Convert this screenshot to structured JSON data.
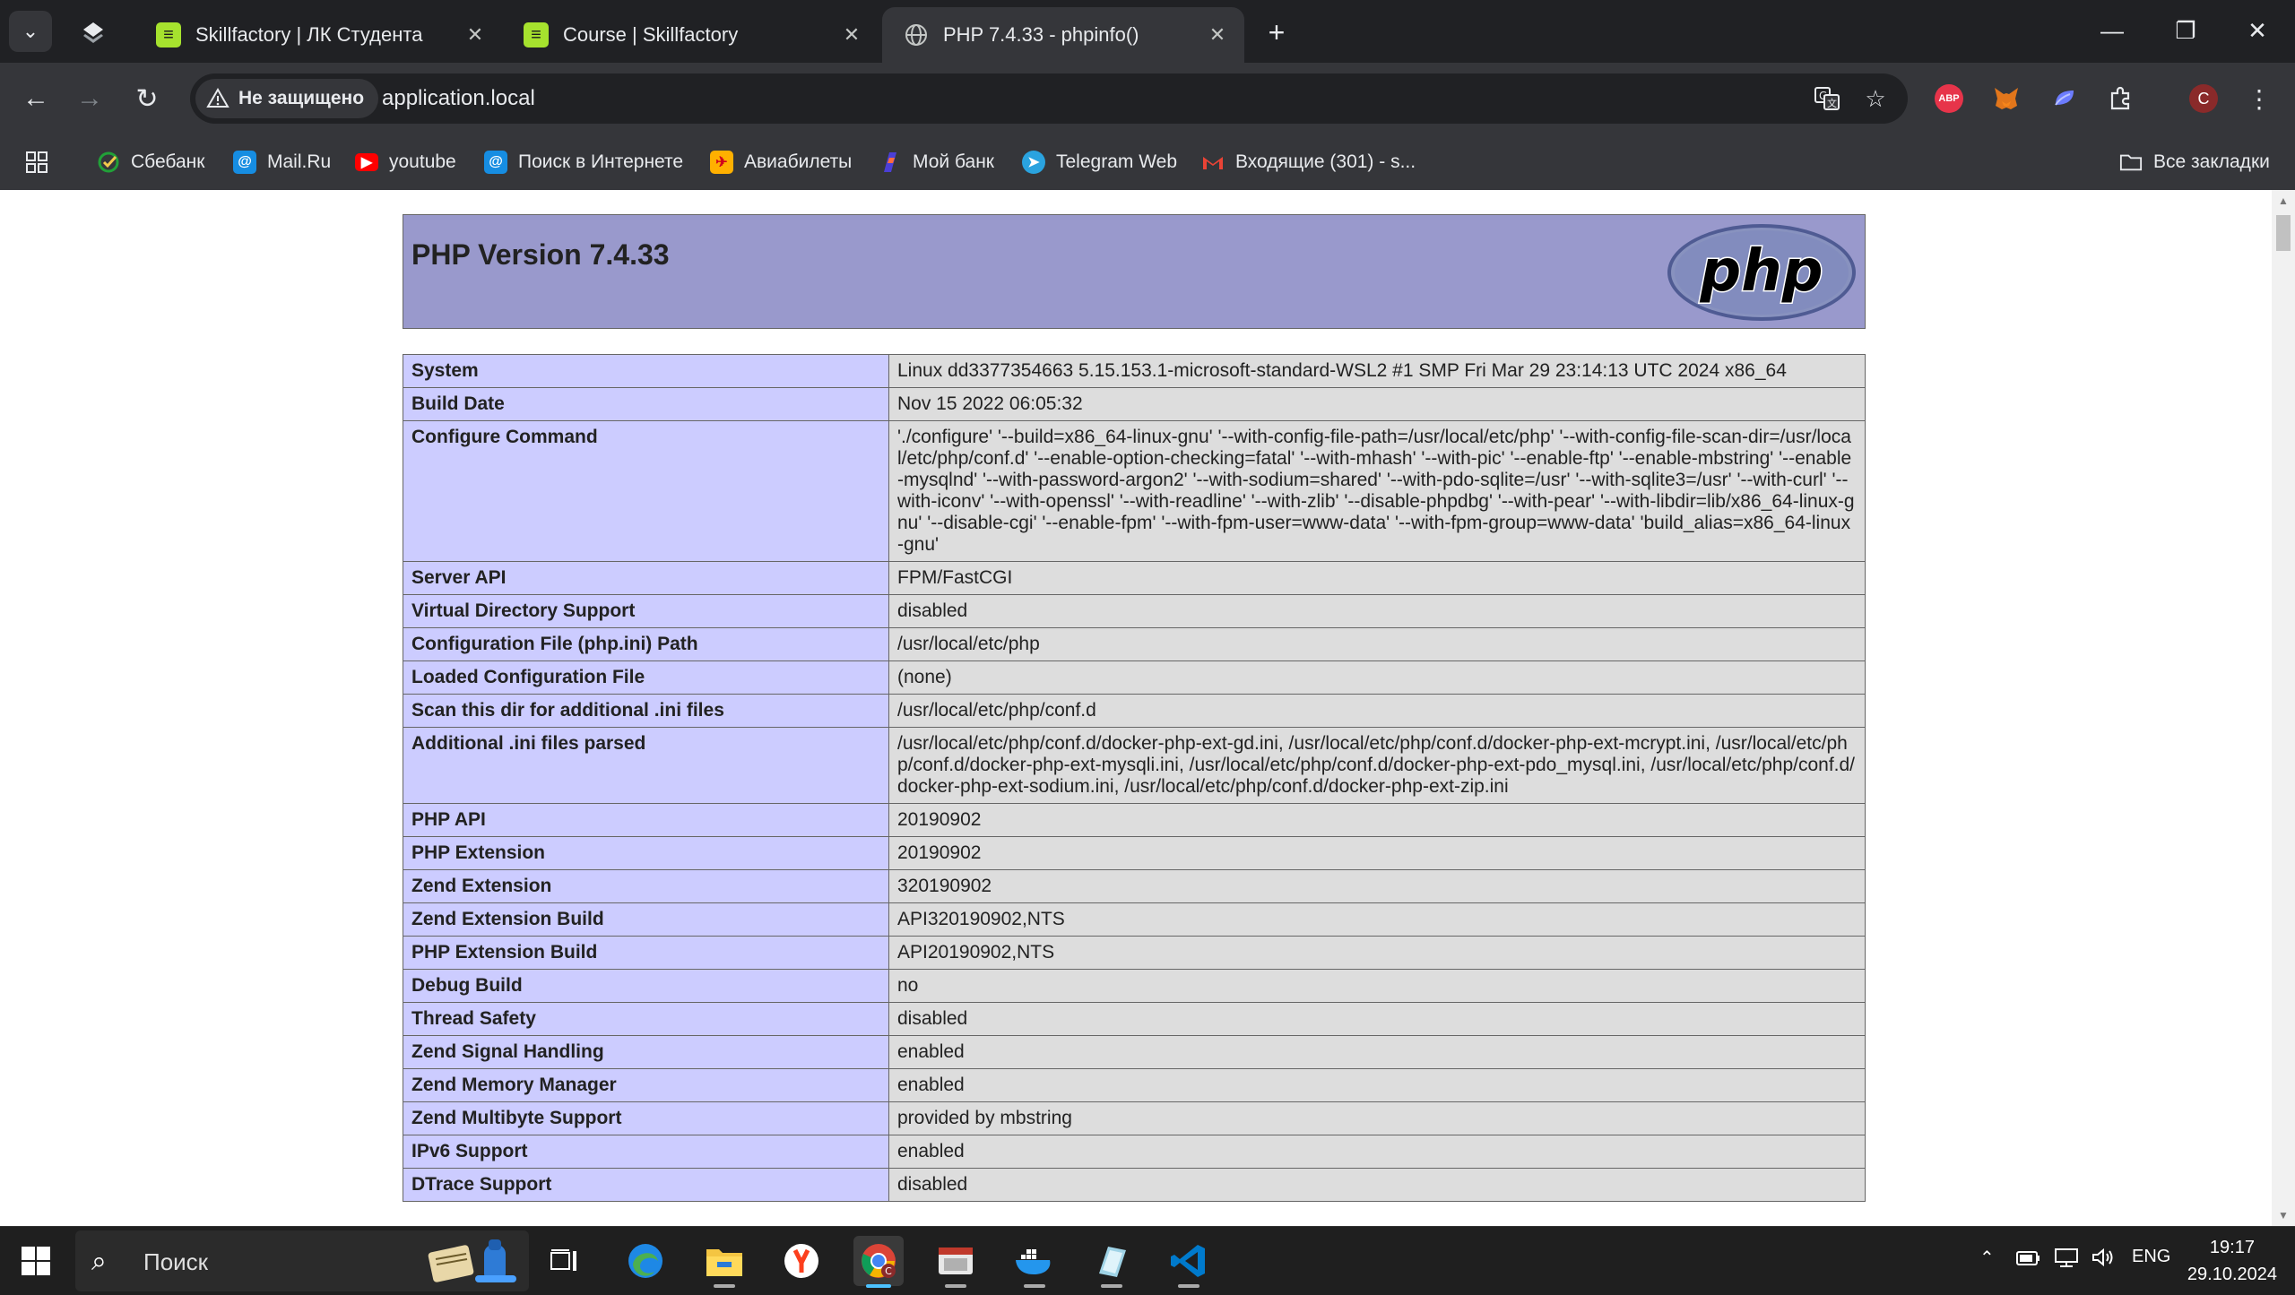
{
  "browser": {
    "tabs": [
      {
        "title": "Skillfactory | ЛК Студента",
        "favicon": "skillfactory-icon"
      },
      {
        "title": "Course | Skillfactory",
        "favicon": "skillfactory-icon"
      },
      {
        "title": "PHP 7.4.33 - phpinfo()",
        "favicon": "globe-icon",
        "active": true
      }
    ],
    "security_label": "Не защищено",
    "url": "application.local",
    "avatar_letter": "C",
    "abp_label": "ABP",
    "bookmarks": [
      {
        "label": "Сбебанк",
        "icon": "sber-icon"
      },
      {
        "label": "Mail.Ru",
        "icon": "mailru-icon"
      },
      {
        "label": "youtube",
        "icon": "youtube-icon"
      },
      {
        "label": "Поиск в Интернете",
        "icon": "search-at-icon"
      },
      {
        "label": "Авиабилеты",
        "icon": "tickets-icon"
      },
      {
        "label": "Мой банк",
        "icon": "bank-icon"
      },
      {
        "label": "Telegram Web",
        "icon": "telegram-icon"
      },
      {
        "label": "Входящие (301) - s...",
        "icon": "gmail-icon"
      }
    ],
    "all_bookmarks": "Все закладки",
    "colors": {
      "tabstrip": "#202124",
      "toolbar": "#35363a"
    }
  },
  "phpinfo": {
    "title": "PHP Version 7.4.33",
    "logo_text": "php",
    "rows": [
      {
        "k": "System",
        "v": "Linux dd3377354663 5.15.153.1-microsoft-standard-WSL2 #1 SMP Fri Mar 29 23:14:13 UTC 2024 x86_64"
      },
      {
        "k": "Build Date",
        "v": "Nov 15 2022 06:05:32"
      },
      {
        "k": "Configure Command",
        "v": "'./configure' '--build=x86_64-linux-gnu' '--with-config-file-path=/usr/local/etc/php' '--with-config-file-scan-dir=/usr/local/etc/php/conf.d' '--enable-option-checking=fatal' '--with-mhash' '--with-pic' '--enable-ftp' '--enable-mbstring' '--enable-mysqlnd' '--with-password-argon2' '--with-sodium=shared' '--with-pdo-sqlite=/usr' '--with-sqlite3=/usr' '--with-curl' '--with-iconv' '--with-openssl' '--with-readline' '--with-zlib' '--disable-phpdbg' '--with-pear' '--with-libdir=lib/x86_64-linux-gnu' '--disable-cgi' '--enable-fpm' '--with-fpm-user=www-data' '--with-fpm-group=www-data' 'build_alias=x86_64-linux-gnu'"
      },
      {
        "k": "Server API",
        "v": "FPM/FastCGI"
      },
      {
        "k": "Virtual Directory Support",
        "v": "disabled"
      },
      {
        "k": "Configuration File (php.ini) Path",
        "v": "/usr/local/etc/php"
      },
      {
        "k": "Loaded Configuration File",
        "v": "(none)"
      },
      {
        "k": "Scan this dir for additional .ini files",
        "v": "/usr/local/etc/php/conf.d"
      },
      {
        "k": "Additional .ini files parsed",
        "v": "/usr/local/etc/php/conf.d/docker-php-ext-gd.ini, /usr/local/etc/php/conf.d/docker-php-ext-mcrypt.ini, /usr/local/etc/php/conf.d/docker-php-ext-mysqli.ini, /usr/local/etc/php/conf.d/docker-php-ext-pdo_mysql.ini, /usr/local/etc/php/conf.d/docker-php-ext-sodium.ini, /usr/local/etc/php/conf.d/docker-php-ext-zip.ini"
      },
      {
        "k": "PHP API",
        "v": "20190902"
      },
      {
        "k": "PHP Extension",
        "v": "20190902"
      },
      {
        "k": "Zend Extension",
        "v": "320190902"
      },
      {
        "k": "Zend Extension Build",
        "v": "API320190902,NTS"
      },
      {
        "k": "PHP Extension Build",
        "v": "API20190902,NTS"
      },
      {
        "k": "Debug Build",
        "v": "no"
      },
      {
        "k": "Thread Safety",
        "v": "disabled"
      },
      {
        "k": "Zend Signal Handling",
        "v": "enabled"
      },
      {
        "k": "Zend Memory Manager",
        "v": "enabled"
      },
      {
        "k": "Zend Multibyte Support",
        "v": "provided by mbstring"
      },
      {
        "k": "IPv6 Support",
        "v": "enabled"
      },
      {
        "k": "DTrace Support",
        "v": "disabled"
      }
    ],
    "colors": {
      "header": "#9999cc",
      "key_cell": "#ccccff",
      "value_cell": "#dddddd"
    }
  },
  "taskbar": {
    "search_label": "Поиск",
    "language": "ENG",
    "time": "19:17",
    "date": "29.10.2024",
    "avatar_letter": "C"
  }
}
